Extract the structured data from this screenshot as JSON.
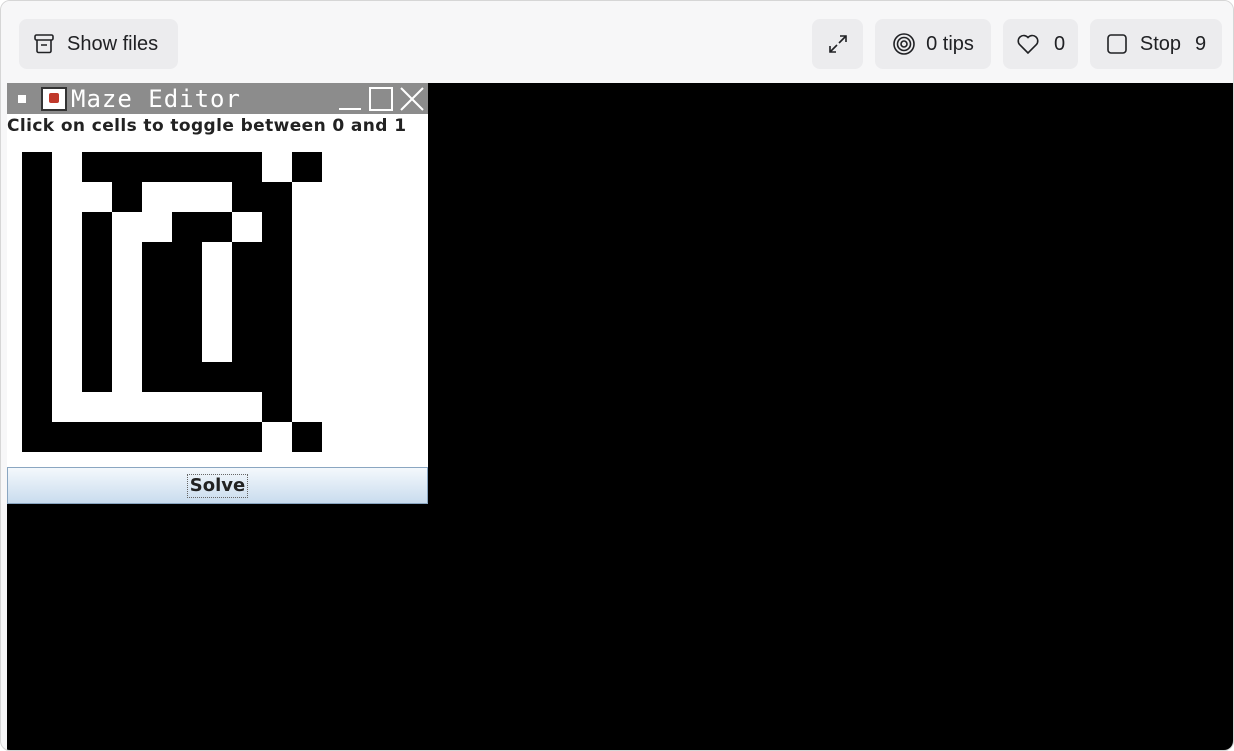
{
  "toolbar": {
    "show_files_label": "Show files",
    "tips_label": "0 tips",
    "likes_count": "0",
    "stop_label": "Stop",
    "stop_count": "9"
  },
  "maze_editor": {
    "title": "Maze Editor",
    "instruction": "Click on cells to toggle between 0 and 1",
    "solve_label": "Solve",
    "grid": [
      [
        1,
        0,
        1,
        1,
        1,
        1,
        1,
        1,
        0,
        1
      ],
      [
        1,
        0,
        0,
        1,
        0,
        0,
        0,
        1,
        1,
        0
      ],
      [
        1,
        0,
        1,
        0,
        0,
        1,
        1,
        0,
        1,
        0
      ],
      [
        1,
        0,
        1,
        0,
        1,
        1,
        0,
        1,
        1,
        0
      ],
      [
        1,
        0,
        1,
        0,
        1,
        1,
        0,
        1,
        1,
        0
      ],
      [
        1,
        0,
        1,
        0,
        1,
        1,
        0,
        1,
        1,
        0
      ],
      [
        1,
        0,
        1,
        0,
        1,
        1,
        0,
        1,
        1,
        0
      ],
      [
        1,
        0,
        1,
        0,
        1,
        1,
        1,
        1,
        1,
        0
      ],
      [
        1,
        0,
        0,
        0,
        0,
        0,
        0,
        0,
        1,
        0
      ],
      [
        1,
        1,
        1,
        1,
        1,
        1,
        1,
        1,
        0,
        1
      ]
    ]
  },
  "colors": {
    "wall": "#000000",
    "open": "#ffffff",
    "desktop": "#000000",
    "titlebar": "#8c8c8c"
  }
}
